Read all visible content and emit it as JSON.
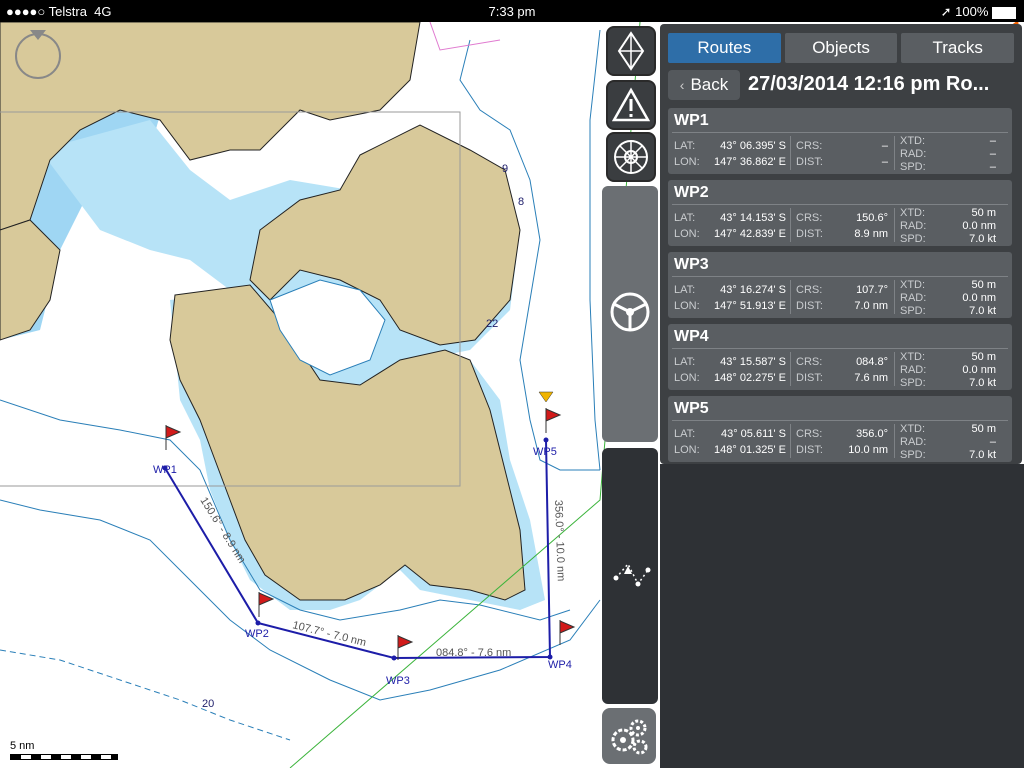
{
  "status": {
    "carrier": "●●●●○ Telstra",
    "network": "4G",
    "time": "7:33 pm",
    "battery": "100%"
  },
  "tabs": [
    {
      "label": "Routes",
      "active": true
    },
    {
      "label": "Objects",
      "active": false
    },
    {
      "label": "Tracks",
      "active": false
    }
  ],
  "back_label": "Back",
  "route_title": "27/03/2014 12:16 pm Ro...",
  "field_labels": {
    "lat": "LAT:",
    "lon": "LON:",
    "crs": "CRS:",
    "dist": "DIST:",
    "xtd": "XTD:",
    "rad": "RAD:",
    "spd": "SPD:"
  },
  "waypoints": [
    {
      "name": "WP1",
      "lat": "43° 06.395' S",
      "lon": "147° 36.862' E",
      "crs": "–",
      "dist": "–",
      "xtd": "–",
      "rad": "–",
      "spd": "–"
    },
    {
      "name": "WP2",
      "lat": "43° 14.153' S",
      "lon": "147° 42.839' E",
      "crs": "150.6°",
      "dist": "8.9 nm",
      "xtd": "50 m",
      "rad": "0.0 nm",
      "spd": "7.0 kt"
    },
    {
      "name": "WP3",
      "lat": "43° 16.274' S",
      "lon": "147° 51.913' E",
      "crs": "107.7°",
      "dist": "7.0 nm",
      "xtd": "50 m",
      "rad": "0.0 nm",
      "spd": "7.0 kt"
    },
    {
      "name": "WP4",
      "lat": "43° 15.587' S",
      "lon": "148° 02.275' E",
      "crs": "084.8°",
      "dist": "7.6 nm",
      "xtd": "50 m",
      "rad": "0.0 nm",
      "spd": "7.0 kt"
    },
    {
      "name": "WP5",
      "lat": "43° 05.611' S",
      "lon": "148° 01.325' E",
      "crs": "356.0°",
      "dist": "10.0 nm",
      "xtd": "50 m",
      "rad": "–",
      "spd": "7.0 kt"
    }
  ],
  "map": {
    "wp_labels": [
      "WP1",
      "WP2",
      "WP3",
      "WP4",
      "WP5"
    ],
    "leg_labels": [
      "150.6° - 8.9 nm",
      "107.7° - 7.0 nm",
      "084.8° - 7.6 nm",
      "356.0° - 10.0 nm"
    ],
    "depths": [
      "9",
      "8",
      "22",
      "20"
    ],
    "scale_label": "5 nm"
  },
  "colors": {
    "land": "#d8c99a",
    "shallow": "#9fd6f3",
    "route": "#1d1da8",
    "accent": "#2e6ea8",
    "flag": "#d11a1a"
  },
  "icons": [
    "compass-icon",
    "boat-icon",
    "warning-icon",
    "compass-rose-icon",
    "helm-icon",
    "route-tool-icon",
    "gears-icon",
    "location-arrow-icon"
  ]
}
